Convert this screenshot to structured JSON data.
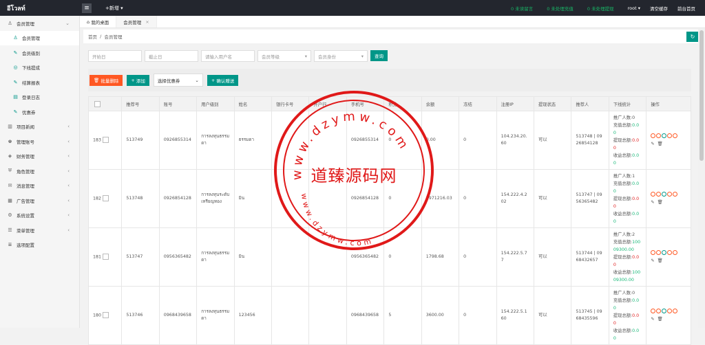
{
  "topbar": {
    "logo": "อีโวลท์",
    "new_label": "+新增",
    "links": [
      "0 未读留言",
      "0 未处理充值",
      "0 未处理提现"
    ],
    "user": "root",
    "clear_cache": "清空缓存",
    "backend_home": "前台首页"
  },
  "sidebar": {
    "items": [
      {
        "label": "会员管理",
        "icon": "user-icon",
        "level": 0,
        "chevron": "v"
      },
      {
        "label": "会员管理",
        "icon": "user-icon",
        "level": 1,
        "active": true
      },
      {
        "label": "会员级别",
        "icon": "edit-icon",
        "level": 1
      },
      {
        "label": "下线提成",
        "icon": "circle-icon",
        "level": 1
      },
      {
        "label": "结算报表",
        "icon": "edit-icon",
        "level": 1
      },
      {
        "label": "登录日志",
        "icon": "file-icon",
        "level": 1
      },
      {
        "label": "优惠券",
        "icon": "edit-icon",
        "level": 1
      },
      {
        "label": "项目新闻",
        "icon": "book-icon",
        "level": 0,
        "chevron": "<"
      },
      {
        "label": "管理账号",
        "icon": "user-group-icon",
        "level": 0,
        "chevron": "<"
      },
      {
        "label": "财务管理",
        "icon": "money-icon",
        "level": 0,
        "chevron": "<"
      },
      {
        "label": "角色管理",
        "icon": "shield-icon",
        "level": 0,
        "chevron": "<"
      },
      {
        "label": "消息管理",
        "icon": "message-icon",
        "level": 0,
        "chevron": "<"
      },
      {
        "label": "广告管理",
        "icon": "image-icon",
        "level": 0,
        "chevron": "<"
      },
      {
        "label": "系统设置",
        "icon": "gear-icon",
        "level": 0,
        "chevron": "<"
      },
      {
        "label": "菜单管理",
        "icon": "menu-icon",
        "level": 0,
        "chevron": "<"
      },
      {
        "label": "选项配置",
        "icon": "list-icon",
        "level": 0,
        "chevron": ""
      }
    ]
  },
  "tabs": [
    {
      "label": "我的桌面",
      "icon": "home-icon"
    },
    {
      "label": "会员管理",
      "active": true,
      "close": "×"
    }
  ],
  "breadcrumb": {
    "home": "首页",
    "sep": "/",
    "current": "会员管理"
  },
  "filters": {
    "start_date": "开始日",
    "end_date": "截止日",
    "username": "请输入用户名",
    "level": "会员等级",
    "identity": "会员身份",
    "search": "查询"
  },
  "actions": {
    "batch_delete": "批量删除",
    "add": "添加",
    "coupon_select": "选择优惠券",
    "confirm_gift": "确认赠送"
  },
  "table": {
    "headers": [
      "",
      "推荐号",
      "账号",
      "用户级别",
      "姓名",
      "银行卡号",
      "开户行",
      "手机号",
      "积分",
      "余额",
      "冻结",
      "注册IP",
      "提现状态",
      "推荐人",
      "下线统计",
      "操作"
    ],
    "rows": [
      {
        "id": "183",
        "ref": "513749",
        "account": "0926855314",
        "level": "การลงทุนธรรมดา",
        "name": "ธรรมดา",
        "bank": "",
        "branch": "",
        "phone": "0926855314",
        "points": "0",
        "balance": "0.00",
        "frozen": "0",
        "ip": "104.234.20.60",
        "wd": "可以",
        "referrer": "513748 | 0926854128",
        "promo": "推广人数:0",
        "recharge": "充值总额:",
        "recharge_val": "0.0",
        "recharge_val2": "0",
        "withdraw": "提现总额:",
        "withdraw_val": "0.0",
        "withdraw_val2": "0",
        "income": "收益总额:",
        "income_val": "0.0",
        "income_val2": "0"
      },
      {
        "id": "182",
        "ref": "513748",
        "account": "0926854128",
        "level": "การลงทุนระดับเหรียญทอง",
        "name": "มิน",
        "bank": "",
        "branch": "",
        "phone": "0926854128",
        "points": "0",
        "balance": "9971216.03",
        "frozen": "0",
        "ip": "154.222.4.202",
        "wd": "可以",
        "referrer": "513747 | 0956365482",
        "promo": "推广人数:1",
        "recharge": "充值总额:",
        "recharge_val": "0.0",
        "recharge_val2": "0",
        "withdraw": "提现总额:",
        "withdraw_val": "0.0",
        "withdraw_val2": "0",
        "income": "收益总额:",
        "income_val": "0.0",
        "income_val2": "0"
      },
      {
        "id": "181",
        "ref": "513747",
        "account": "0956365482",
        "level": "การลงทุนธรรมดา",
        "name": "มิน",
        "bank": "",
        "branch": "",
        "phone": "0956365482",
        "points": "0",
        "balance": "1798.68",
        "frozen": "0",
        "ip": "154.222.5.77",
        "wd": "可以",
        "referrer": "513744 | 0968432657",
        "promo": "推广人数:2",
        "recharge": "充值总额:",
        "recharge_val": "100",
        "recharge_val2": "09300.00",
        "withdraw": "提现总额:",
        "withdraw_val": "0.0",
        "withdraw_val2": "0",
        "income": "收益总额:",
        "income_val": "100",
        "income_val2": "09300.00"
      },
      {
        "id": "180",
        "ref": "513746",
        "account": "0968439658",
        "level": "การลงทุนธรรมดา",
        "name": "123456",
        "bank": "",
        "branch": "",
        "phone": "0968439658",
        "points": "5",
        "balance": "3600.00",
        "frozen": "0",
        "ip": "154.222.5.160",
        "wd": "可以",
        "referrer": "513745 | 0968435596",
        "promo": "推广人数:0",
        "recharge": "充值总额:",
        "recharge_val": "0.0",
        "recharge_val2": "0",
        "withdraw": "提现总额:",
        "withdraw_val": "0.0",
        "withdraw_val2": "0",
        "income": "收益总额:",
        "income_val": "0.0",
        "income_val2": "0"
      }
    ]
  },
  "watermark": {
    "top": "www.dzymw.com",
    "center": "道臻源码网",
    "bottom": "www.dzymw.com"
  }
}
